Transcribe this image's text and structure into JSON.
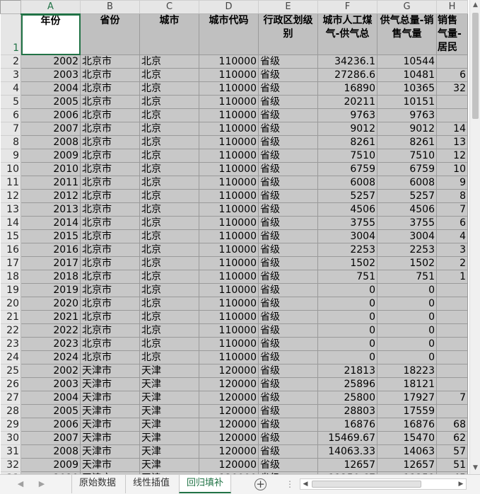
{
  "columns": [
    "A",
    "B",
    "C",
    "D",
    "E",
    "F",
    "G",
    "H"
  ],
  "headers": [
    "年份",
    "省份",
    "城市",
    "城市代码",
    "行政区划级别",
    "城市人工煤气-供气总",
    "供气总量-销售气量",
    "销售气量-居民"
  ],
  "rows": [
    {
      "row": "2",
      "cells": [
        "2002",
        "北京市",
        "北京",
        "110000",
        "省级",
        "34236.1",
        "10544",
        ""
      ]
    },
    {
      "row": "3",
      "cells": [
        "2003",
        "北京市",
        "北京",
        "110000",
        "省级",
        "27286.6",
        "10481",
        "6"
      ]
    },
    {
      "row": "4",
      "cells": [
        "2004",
        "北京市",
        "北京",
        "110000",
        "省级",
        "16890",
        "10365",
        "32"
      ]
    },
    {
      "row": "5",
      "cells": [
        "2005",
        "北京市",
        "北京",
        "110000",
        "省级",
        "20211",
        "10151",
        ""
      ]
    },
    {
      "row": "6",
      "cells": [
        "2006",
        "北京市",
        "北京",
        "110000",
        "省级",
        "9763",
        "9763",
        ""
      ]
    },
    {
      "row": "7",
      "cells": [
        "2007",
        "北京市",
        "北京",
        "110000",
        "省级",
        "9012",
        "9012",
        "14"
      ]
    },
    {
      "row": "8",
      "cells": [
        "2008",
        "北京市",
        "北京",
        "110000",
        "省级",
        "8261",
        "8261",
        "13"
      ]
    },
    {
      "row": "9",
      "cells": [
        "2009",
        "北京市",
        "北京",
        "110000",
        "省级",
        "7510",
        "7510",
        "12"
      ]
    },
    {
      "row": "10",
      "cells": [
        "2010",
        "北京市",
        "北京",
        "110000",
        "省级",
        "6759",
        "6759",
        "10"
      ]
    },
    {
      "row": "11",
      "cells": [
        "2011",
        "北京市",
        "北京",
        "110000",
        "省级",
        "6008",
        "6008",
        "9"
      ]
    },
    {
      "row": "12",
      "cells": [
        "2012",
        "北京市",
        "北京",
        "110000",
        "省级",
        "5257",
        "5257",
        "8"
      ]
    },
    {
      "row": "13",
      "cells": [
        "2013",
        "北京市",
        "北京",
        "110000",
        "省级",
        "4506",
        "4506",
        "7"
      ]
    },
    {
      "row": "14",
      "cells": [
        "2014",
        "北京市",
        "北京",
        "110000",
        "省级",
        "3755",
        "3755",
        "6"
      ]
    },
    {
      "row": "15",
      "cells": [
        "2015",
        "北京市",
        "北京",
        "110000",
        "省级",
        "3004",
        "3004",
        "4"
      ]
    },
    {
      "row": "16",
      "cells": [
        "2016",
        "北京市",
        "北京",
        "110000",
        "省级",
        "2253",
        "2253",
        "3"
      ]
    },
    {
      "row": "17",
      "cells": [
        "2017",
        "北京市",
        "北京",
        "110000",
        "省级",
        "1502",
        "1502",
        "2"
      ]
    },
    {
      "row": "18",
      "cells": [
        "2018",
        "北京市",
        "北京",
        "110000",
        "省级",
        "751",
        "751",
        "1"
      ]
    },
    {
      "row": "19",
      "cells": [
        "2019",
        "北京市",
        "北京",
        "110000",
        "省级",
        "0",
        "0",
        ""
      ]
    },
    {
      "row": "20",
      "cells": [
        "2020",
        "北京市",
        "北京",
        "110000",
        "省级",
        "0",
        "0",
        ""
      ]
    },
    {
      "row": "21",
      "cells": [
        "2021",
        "北京市",
        "北京",
        "110000",
        "省级",
        "0",
        "0",
        ""
      ]
    },
    {
      "row": "22",
      "cells": [
        "2022",
        "北京市",
        "北京",
        "110000",
        "省级",
        "0",
        "0",
        ""
      ]
    },
    {
      "row": "23",
      "cells": [
        "2023",
        "北京市",
        "北京",
        "110000",
        "省级",
        "0",
        "0",
        ""
      ]
    },
    {
      "row": "24",
      "cells": [
        "2024",
        "北京市",
        "北京",
        "110000",
        "省级",
        "0",
        "0",
        ""
      ]
    },
    {
      "row": "25",
      "cells": [
        "2002",
        "天津市",
        "天津",
        "120000",
        "省级",
        "21813",
        "18223",
        ""
      ]
    },
    {
      "row": "26",
      "cells": [
        "2003",
        "天津市",
        "天津",
        "120000",
        "省级",
        "25896",
        "18121",
        ""
      ]
    },
    {
      "row": "27",
      "cells": [
        "2004",
        "天津市",
        "天津",
        "120000",
        "省级",
        "25800",
        "17927",
        "7"
      ]
    },
    {
      "row": "28",
      "cells": [
        "2005",
        "天津市",
        "天津",
        "120000",
        "省级",
        "28803",
        "17559",
        ""
      ]
    },
    {
      "row": "29",
      "cells": [
        "2006",
        "天津市",
        "天津",
        "120000",
        "省级",
        "16876",
        "16876",
        "68"
      ]
    },
    {
      "row": "30",
      "cells": [
        "2007",
        "天津市",
        "天津",
        "120000",
        "省级",
        "15469.67",
        "15470",
        "62"
      ]
    },
    {
      "row": "31",
      "cells": [
        "2008",
        "天津市",
        "天津",
        "120000",
        "省级",
        "14063.33",
        "14063",
        "57"
      ]
    },
    {
      "row": "32",
      "cells": [
        "2009",
        "天津市",
        "天津",
        "120000",
        "省级",
        "12657",
        "12657",
        "51"
      ]
    },
    {
      "row": "33",
      "cells": [
        "2010",
        "天津市",
        "天津",
        "120000",
        "省级",
        "11250.67",
        "11251",
        "45"
      ]
    }
  ],
  "sheet_tabs": [
    "原始数据",
    "线性插值",
    "回归填补"
  ],
  "active_tab": "回归填补"
}
